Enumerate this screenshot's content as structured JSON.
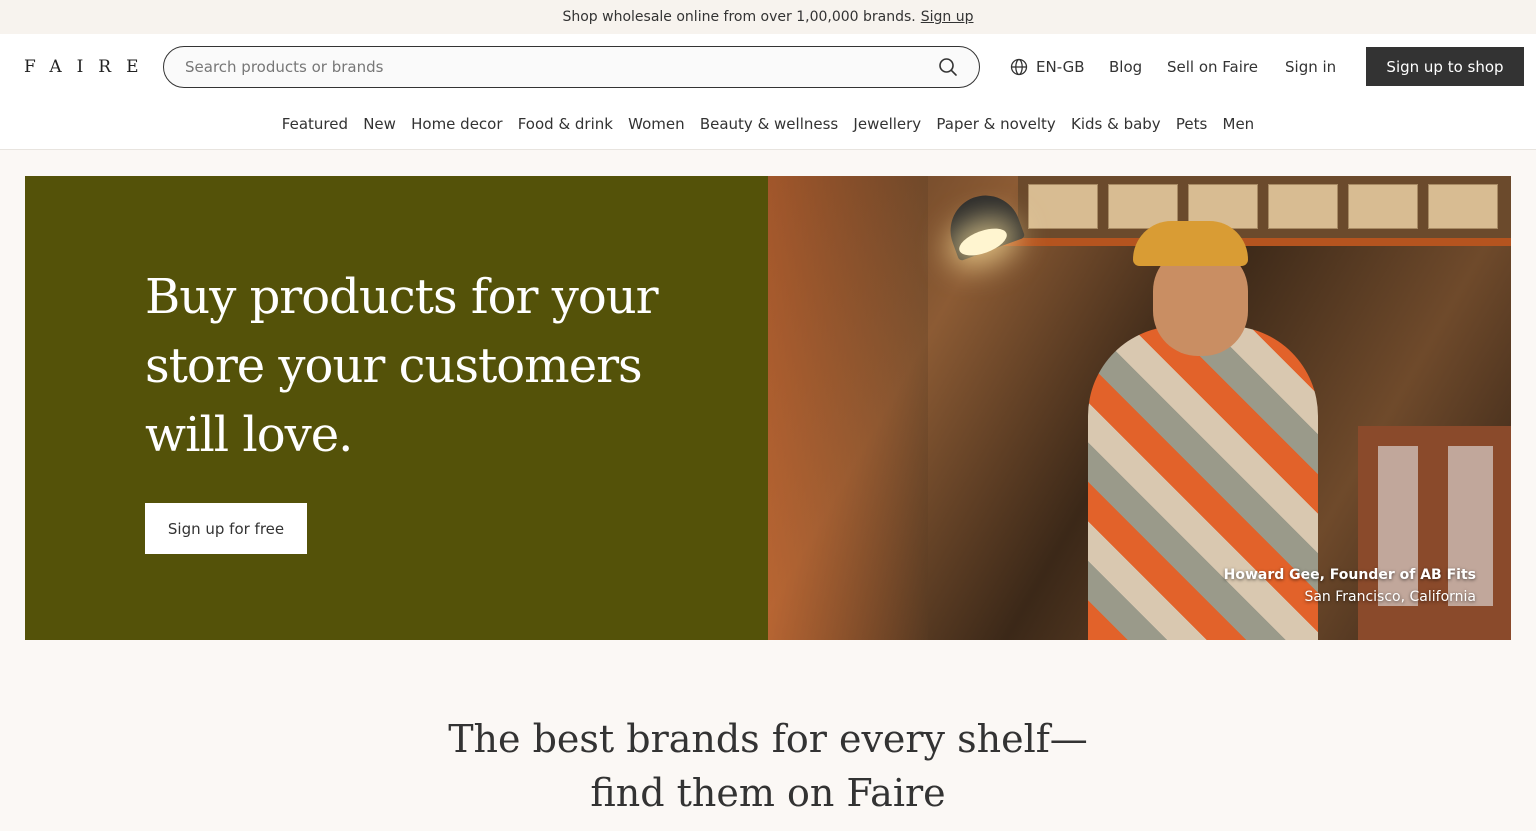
{
  "announcement": {
    "text": "Shop wholesale online from over 1,00,000 brands.",
    "link": "Sign up"
  },
  "header": {
    "logo": "FAIRE",
    "search_placeholder": "Search products or brands",
    "language": "EN-GB",
    "blog": "Blog",
    "sell": "Sell on Faire",
    "sign_in": "Sign in",
    "sign_up_shop": "Sign up to shop"
  },
  "categories": [
    "Featured",
    "New",
    "Home decor",
    "Food & drink",
    "Women",
    "Beauty & wellness",
    "Jewellery",
    "Paper & novelty",
    "Kids & baby",
    "Pets",
    "Men"
  ],
  "hero": {
    "title": "Buy products for your store your customers will love.",
    "button": "Sign up for free",
    "caption_name": "Howard Gee, Founder of AB Fits",
    "caption_location": "San Francisco, California",
    "bg_color": "#545209"
  },
  "section": {
    "title_line1": "The best brands for every shelf—",
    "title_line2": "find them on Faire"
  },
  "icons": {
    "search": "search-icon",
    "globe": "globe-icon"
  }
}
